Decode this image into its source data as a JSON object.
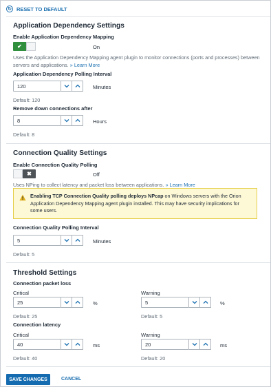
{
  "header": {
    "reset_label": "RESET TO DEFAULT",
    "reset_icon": "refresh-icon"
  },
  "app_dep": {
    "title": "Application Dependency Settings",
    "enable_label": "Enable Application Dependency Mapping",
    "enable_state": "On",
    "enabled": true,
    "description": "Uses the Application Dependency Mapping agent plugin to monitor connections (ports and processes) between servers and applications.",
    "learn_more": "» Learn More",
    "polling_label": "Application Dependency Polling Interval",
    "polling_value": "120",
    "polling_unit": "Minutes",
    "polling_default": "Default: 120",
    "remove_label": "Remove down connections after",
    "remove_value": "8",
    "remove_unit": "Hours",
    "remove_default": "Default: 8"
  },
  "conn_quality": {
    "title": "Connection Quality Settings",
    "enable_label": "Enable Connection Quality Polling",
    "enable_state": "Off",
    "enabled": false,
    "description": "Uses NPing to collect latency and packet loss between applications.",
    "learn_more": "» Learn More",
    "warning_bold": "Enabling TCP Connection Quality polling deploys NPcap",
    "warning_text": " on Windows servers with the Orion Application Dependency Mapping agent plugin installed. This may have security implications for some users.",
    "interval_label": "Connection Quality Polling Interval",
    "interval_value": "5",
    "interval_unit": "Minutes",
    "interval_default": "Default: 5"
  },
  "threshold": {
    "title": "Threshold Settings",
    "packet_loss_label": "Connection packet loss",
    "latency_label": "Connection latency",
    "critical_label": "Critical",
    "warning_label": "Warning",
    "pl_critical_value": "25",
    "pl_critical_unit": "%",
    "pl_critical_default": "Default: 25",
    "pl_warning_value": "5",
    "pl_warning_unit": "%",
    "pl_warning_default": "Default: 5",
    "lat_critical_value": "40",
    "lat_critical_unit": "ms",
    "lat_critical_default": "Default: 40",
    "lat_warning_value": "20",
    "lat_warning_unit": "ms",
    "lat_warning_default": "Default: 20"
  },
  "footer": {
    "save_label": "SAVE CHANGES",
    "cancel_label": "CANCEL"
  },
  "colors": {
    "accent": "#1a6fb0",
    "toggle_on": "#2f8f3c",
    "toggle_off": "#4e5358",
    "warning_bg": "#fdf8d6"
  }
}
